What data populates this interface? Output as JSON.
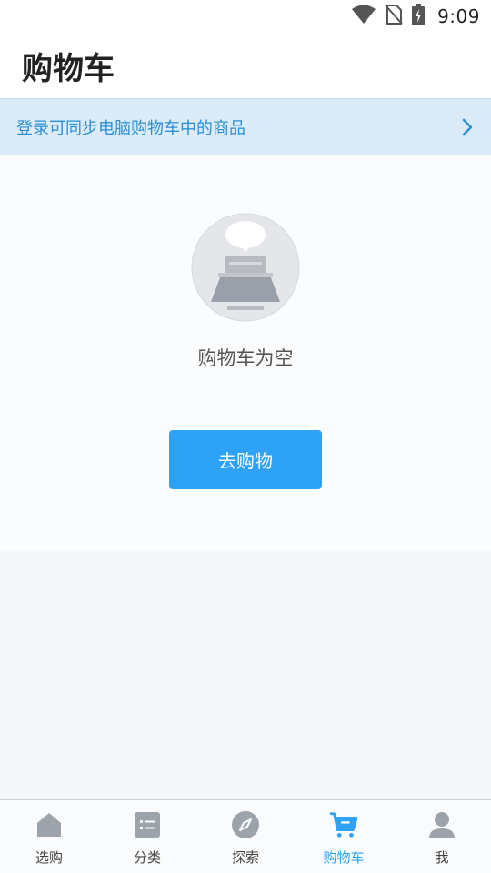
{
  "status_bar": {
    "time": "9:09"
  },
  "header": {
    "title": "购物车"
  },
  "login_banner": {
    "text": "登录可同步电脑购物车中的商品"
  },
  "empty_state": {
    "message": "购物车为空",
    "button_label": "去购物"
  },
  "tabs": [
    {
      "label": "选购",
      "icon": "home-icon",
      "active": false
    },
    {
      "label": "分类",
      "icon": "category-list-icon",
      "active": false
    },
    {
      "label": "探索",
      "icon": "compass-icon",
      "active": false
    },
    {
      "label": "购物车",
      "icon": "cart-icon",
      "active": true
    },
    {
      "label": "我",
      "icon": "person-icon",
      "active": false
    }
  ],
  "colors": {
    "accent": "#2ea2f7",
    "banner_bg": "#dcebf9",
    "banner_text": "#2a8fd6",
    "inactive_icon": "#9da3ab"
  }
}
